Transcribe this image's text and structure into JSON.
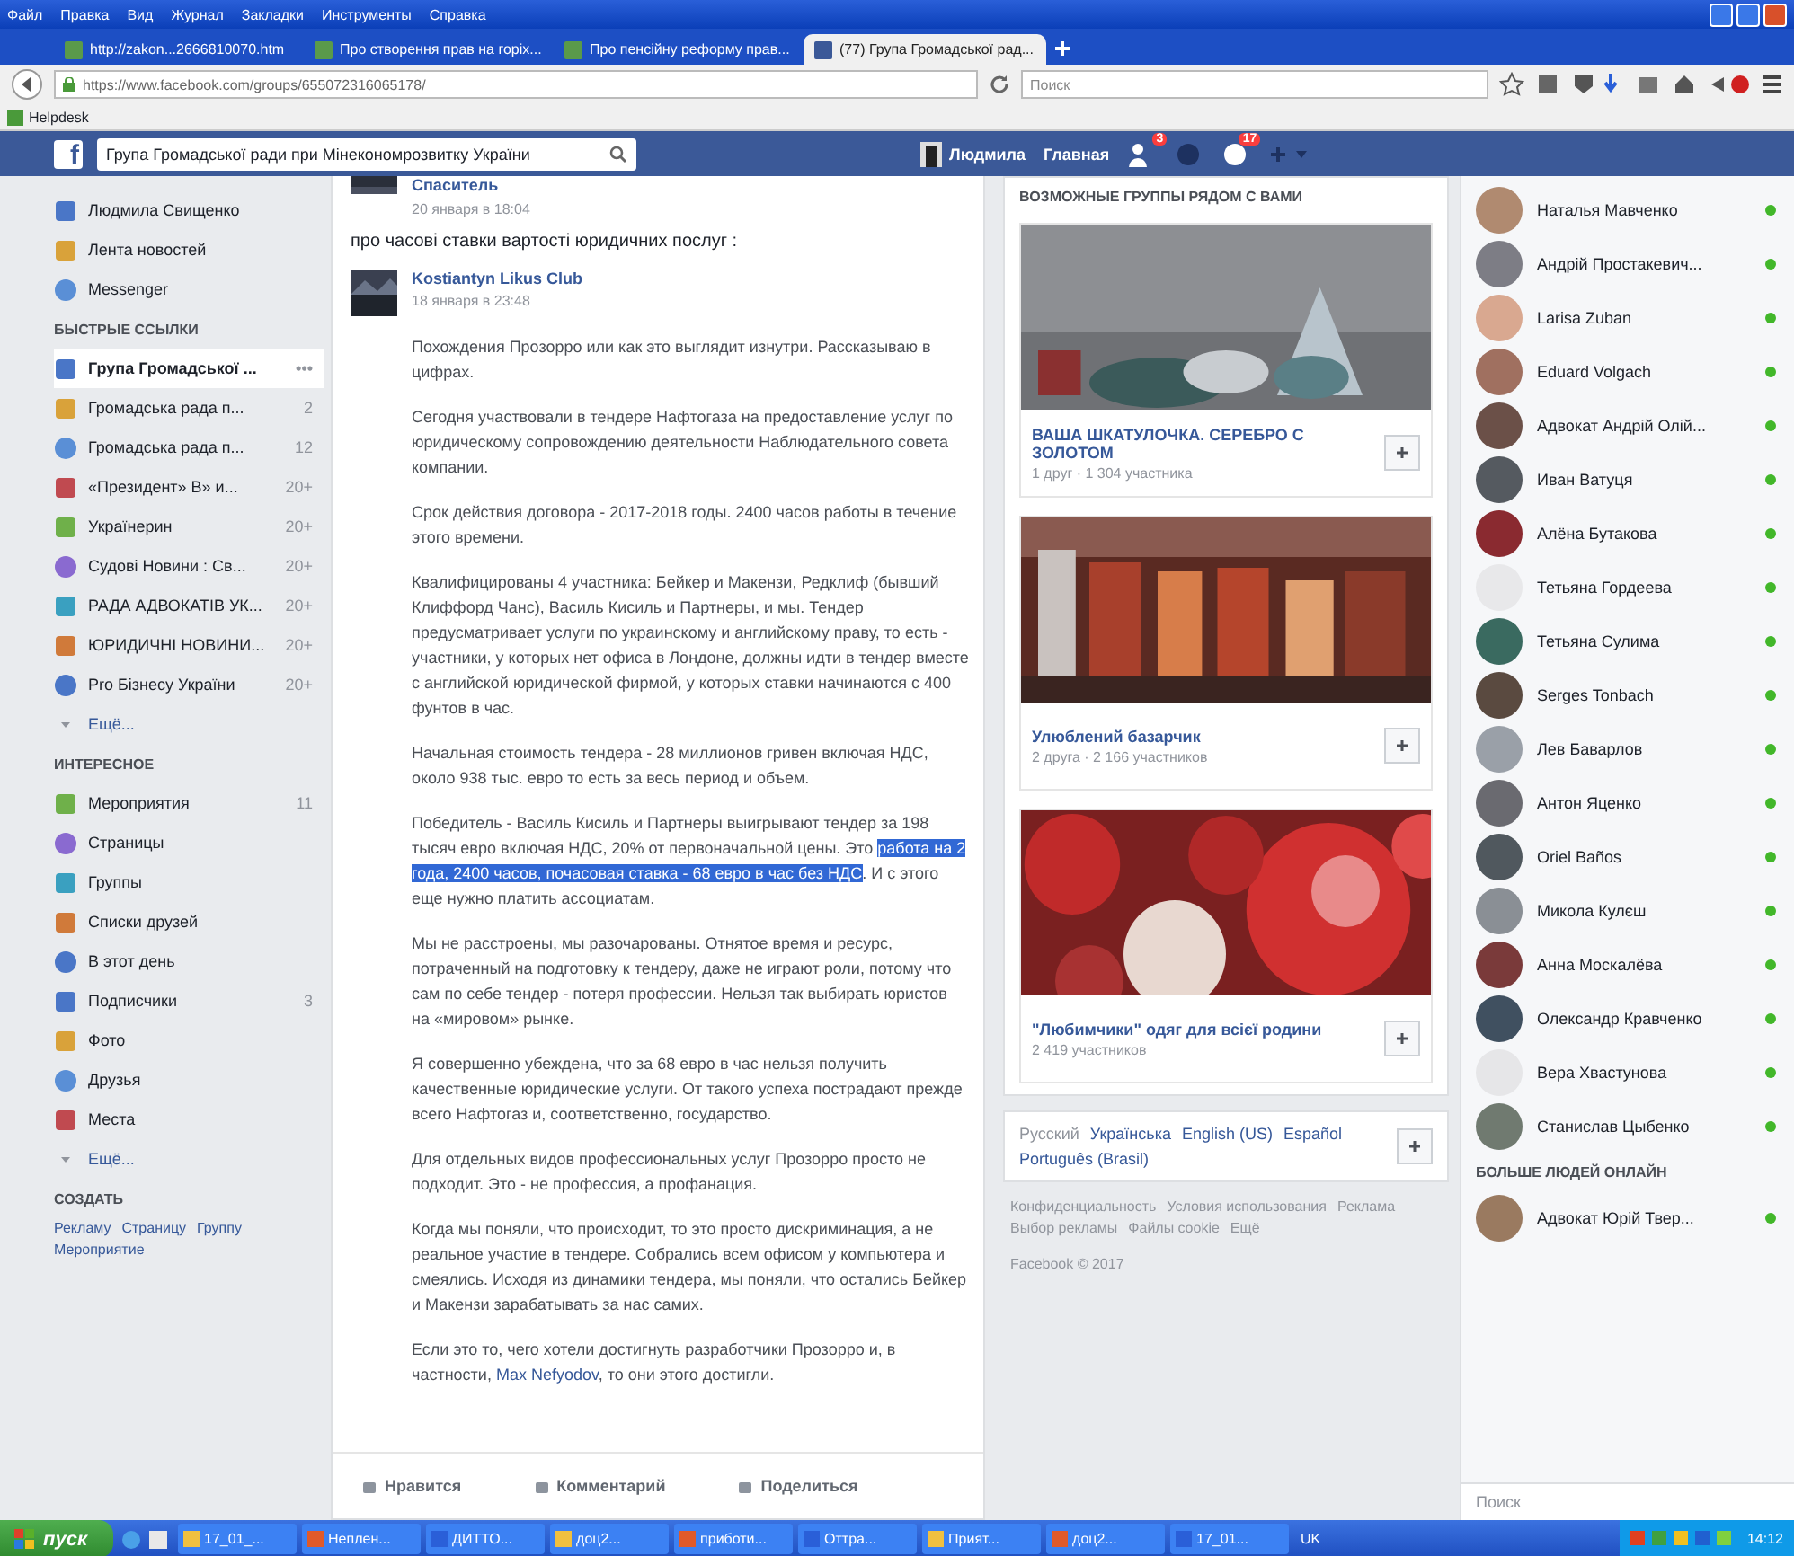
{
  "browser": {
    "menu": [
      "Файл",
      "Правка",
      "Вид",
      "Журнал",
      "Закладки",
      "Инструменты",
      "Справка"
    ],
    "tabs": [
      {
        "label": "http://zakon...2666810070.htm",
        "selected": false
      },
      {
        "label": "Про створення прав на горіх...",
        "selected": false
      },
      {
        "label": "Про пенсійну реформу прав...",
        "selected": false
      },
      {
        "label": "(77) Група Громадської рад...",
        "selected": true
      }
    ],
    "address": "https://www.facebook.com/groups/655072316065178/",
    "search_placeholder": "Поиск",
    "bookmarks": [
      "Helpdesk"
    ]
  },
  "facebook_bar": {
    "logo": "f",
    "search": "Група Громадської ради при Мінекономрозвитку України",
    "profile": "Людмила",
    "home": "Главная",
    "badges": [
      "3",
      "17"
    ]
  },
  "sidebar": {
    "top_items": [
      {
        "label": "Людмила Свищенко",
        "selected": false
      },
      {
        "label": "Лента новостей",
        "selected": false
      },
      {
        "label": "Messenger",
        "selected": false
      }
    ],
    "sections": [
      {
        "title": "БЫСТРЫЕ ССЫЛКИ",
        "more": "Ещё...",
        "items": [
          {
            "label": "Група Громадської ...",
            "count": "•••",
            "selected": true
          },
          {
            "label": "Громадська рада п...",
            "count": "2",
            "selected": false
          },
          {
            "label": "Громадська рада п...",
            "count": "12",
            "selected": false
          },
          {
            "label": "«Президент» В» и...",
            "count": "20+",
            "selected": false
          },
          {
            "label": "Українерин",
            "count": "20+",
            "selected": false
          },
          {
            "label": "Судові Новини : Св...",
            "count": "20+",
            "selected": false
          },
          {
            "label": "РАДА АДВОКАТІВ УК...",
            "count": "20+",
            "selected": false
          },
          {
            "label": "ЮРИДИЧНІ НОВИНИ...",
            "count": "20+",
            "selected": false
          },
          {
            "label": "Pro Бізнесу України",
            "count": "20+",
            "selected": false
          }
        ]
      },
      {
        "title": "ИНТЕРЕСНОЕ",
        "more": "Ещё...",
        "items": [
          {
            "label": "Мероприятия",
            "count": "11",
            "selected": false
          },
          {
            "label": "Страницы",
            "selected": false
          },
          {
            "label": "Группы",
            "selected": false
          },
          {
            "label": "Списки друзей",
            "selected": false
          },
          {
            "label": "В этот день",
            "selected": false
          },
          {
            "label": "Подписчики",
            "count": "3",
            "selected": false
          },
          {
            "label": "Фото",
            "selected": false
          },
          {
            "label": "Друзья",
            "selected": false
          },
          {
            "label": "Места",
            "selected": false
          }
        ]
      }
    ],
    "create": {
      "title": "СОЗДАТЬ",
      "links": [
        "Рекламу",
        "Страницу",
        "Группу",
        "Мероприятие"
      ]
    }
  },
  "post": {
    "author": "Спаситель",
    "time": "20 января в 18:04",
    "text": "про часові ставки вартості юридичних послуг :",
    "shared": {
      "author": "Kostiantyn Likus Club",
      "time": "18 января в 23:48",
      "paragraphs": [
        [
          {
            "kind": "text",
            "text": "Похождения Прозорро или как это выглядит изнутри. Рассказываю в цифрах."
          }
        ],
        [
          {
            "kind": "text",
            "text": "Сегодня участвовали в тендере Нафтогаза на предоставление услуг по юридическому сопровождению деятельности Наблюдательного совета компании."
          }
        ],
        [
          {
            "kind": "text",
            "text": "Срок действия договора - 2017-2018 годы. 2400 часов работы в течение этого времени."
          }
        ],
        [
          {
            "kind": "text",
            "text": "Квалифицированы 4 участника: Бейкер и Макензи, Редклиф (бывший Клиффорд Чанс), Василь Кисиль и Партнеры, и мы. Тендер предусматривает услуги по украинскому и английскому праву, то есть - участники, у которых нет офиса в Лондоне, должны идти в тендер вместе с английской юридической фирмой, у которых ставки начинаются с 400 фунтов в час."
          }
        ],
        [
          {
            "kind": "text",
            "text": "Начальная стоимость тендера - 28 миллионов гривен включая НДС, около 938 тыс. евро то есть за весь период и объем."
          }
        ],
        [
          {
            "kind": "text",
            "text": "Победитель - Василь Кисиль и Партнеры выигрывают тендер за 198 тысяч евро включая НДС, 20% от первоначальной цены. Это "
          },
          {
            "kind": "highlight",
            "text": "работа на 2 года, 2400 часов, почасовая ставка - 68 евро в час без НДС"
          },
          {
            "kind": "text",
            "text": ". И с этого еще нужно платить ассоциатам."
          }
        ],
        [
          {
            "kind": "text",
            "text": "Мы не расстроены, мы разочарованы. Отнятое время и ресурс, потраченный на подготовку к тендеру, даже не играют роли, потому что сам по себе тендер - потеря профессии. Нельзя так выбирать юристов на «мировом» рынке."
          }
        ],
        [
          {
            "kind": "text",
            "text": "Я совершенно убеждена, что за 68 евро в час нельзя получить качественные юридические услуги. От такого успеха пострадают прежде всего Нафтогаз и, соответственно, государство."
          }
        ],
        [
          {
            "kind": "text",
            "text": "Для отдельных видов профессиональных услуг Прозорро просто не подходит. Это - не профессия, а профанация."
          }
        ],
        [
          {
            "kind": "text",
            "text": "Когда мы поняли, что происходит, то это просто дискриминация, а не реальное участие в тендере. Собрались всем офисом у компьютера и смеялись. Исходя из динамики тендера, мы поняли, что остались Бейкер и Макензи зарабатывать за нас самих."
          }
        ],
        [
          {
            "kind": "text",
            "text": "Если это то, чего хотели достигнуть разработчики Прозорро и, в частности, "
          },
          {
            "kind": "link",
            "text": "Max Nefyodov"
          },
          {
            "kind": "text",
            "text": ", то они этого достигли."
          }
        ]
      ]
    },
    "actions": [
      "Нравится",
      "Комментарий",
      "Поделиться"
    ]
  },
  "suggested_groups": {
    "title": "ВОЗМОЖНЫЕ ГРУППЫ РЯДОМ С ВАМИ",
    "groups": [
      {
        "name": "ВАША ШКАТУЛОЧКА. СЕРЕБРО С ЗОЛОТОМ",
        "meta": "1 друг · 1 304 участника",
        "kind": "picture"
      },
      {
        "name": "Улюблений базарчик",
        "meta": "2 друга · 2 166 участников",
        "kind": "picture"
      },
      {
        "name": "\"Любимчики\" одяг для всієї родини",
        "meta": "2 419 участников",
        "kind": "picture"
      }
    ]
  },
  "languages": [
    "Русский",
    "Українська",
    "English (US)",
    "Español",
    "Português (Brasil)"
  ],
  "footer": {
    "links": [
      "Конфиденциальность",
      "Условия использования",
      "Реклама",
      "Выбор рекламы",
      "Файлы cookie",
      "Ещё"
    ],
    "copyright": "Facebook © 2017"
  },
  "chat": {
    "contacts": [
      {
        "name": "Наталья Мавченко",
        "online": true
      },
      {
        "name": "Андрій Простакевич...",
        "online": true
      },
      {
        "name": "Larisa Zuban",
        "online": true
      },
      {
        "name": "Eduard Volgach",
        "online": true
      },
      {
        "name": "Адвокат Андрій Олій...",
        "online": true
      },
      {
        "name": "Иван Ватуця",
        "online": true
      },
      {
        "name": "Алёна Бутакова",
        "online": true
      },
      {
        "name": "Тетьяна Гордеева",
        "online": true
      },
      {
        "name": "Тетьяна Сулима",
        "online": true
      },
      {
        "name": "Serges Tonbach",
        "online": true
      },
      {
        "name": "Лев Баварлов",
        "online": true
      },
      {
        "name": "Антон Яценко",
        "online": true
      },
      {
        "name": "Oriel Baños",
        "online": true
      },
      {
        "name": "Микола Кулєш",
        "online": true
      },
      {
        "name": "Анна Москалёва",
        "online": true
      },
      {
        "name": "Олександр Кравченко",
        "online": true
      },
      {
        "name": "Вера Хвастунова",
        "online": true
      },
      {
        "name": "Станислав Цыбенко",
        "online": true
      }
    ],
    "more_title": "БОЛЬШЕ ЛЮДЕЙ ОНЛАЙН",
    "more": [
      {
        "name": "Адвокат Юрій Твер...",
        "online": true
      }
    ],
    "search_placeholder": "Поиск"
  },
  "taskbar": {
    "start": "пуск",
    "windows": [
      "17_01_...",
      "Неплен...",
      "ДИТТО...",
      "доц2...",
      "приботи...",
      "Оттра...",
      "Прият...",
      "доц2...",
      "17_01..."
    ],
    "language": "UK",
    "clock": "14:12"
  }
}
